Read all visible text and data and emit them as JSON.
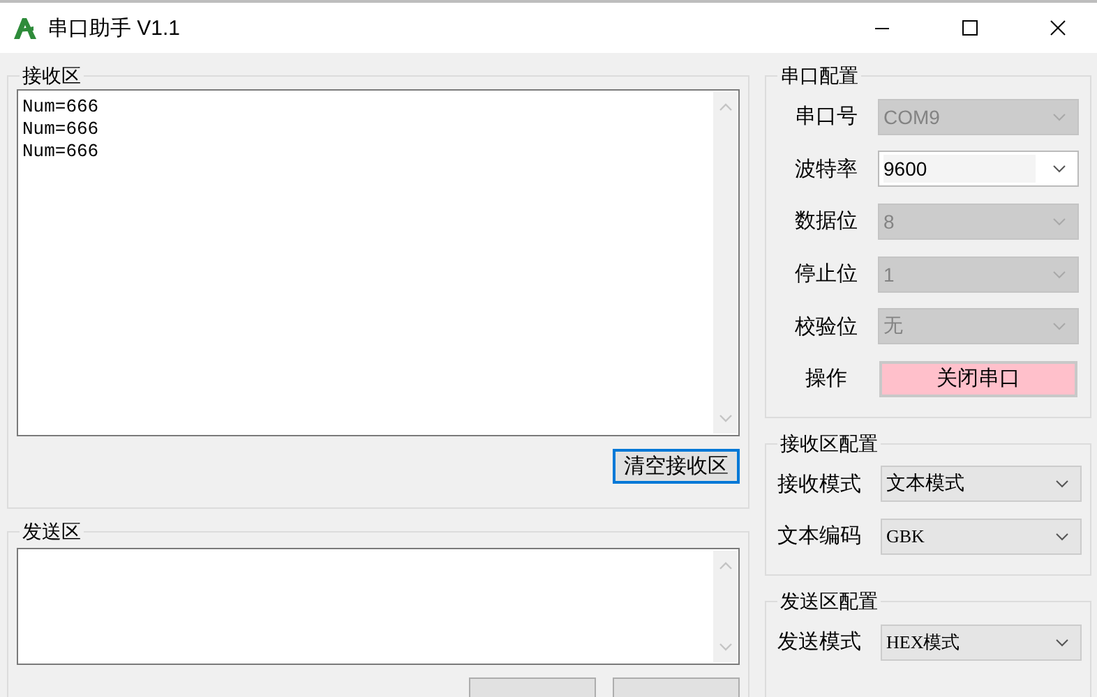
{
  "window": {
    "title": "串口助手 V1.1"
  },
  "receive_area": {
    "title": "接收区",
    "lines": [
      "Num=666",
      "Num=666",
      "Num=666"
    ],
    "clear_button": "清空接收区"
  },
  "send_area": {
    "title": "发送区"
  },
  "config_groups": [
    {
      "title": "串口配置",
      "rows": [
        {
          "label": "串口号",
          "kind": "combo",
          "value": "COM9",
          "disabled": true,
          "mono": false
        },
        {
          "label": "波特率",
          "kind": "editable",
          "value": "9600",
          "disabled": false,
          "mono": false
        },
        {
          "label": "数据位",
          "kind": "combo",
          "value": "8",
          "disabled": true,
          "mono": false
        },
        {
          "label": "停止位",
          "kind": "combo",
          "value": "1",
          "disabled": true,
          "mono": false
        },
        {
          "label": "校验位",
          "kind": "combo",
          "value": "无",
          "disabled": true,
          "mono": false
        },
        {
          "label": "操作",
          "kind": "button",
          "value": "关闭串口"
        }
      ]
    },
    {
      "title": "接收区配置",
      "rows": [
        {
          "label": "接收模式",
          "kind": "combo",
          "value": "文本模式",
          "disabled": false,
          "mono": false
        },
        {
          "label": "文本编码",
          "kind": "combo",
          "value": "GBK",
          "disabled": false,
          "mono": true
        }
      ]
    },
    {
      "title": "发送区配置",
      "rows": [
        {
          "label": "发送模式",
          "kind": "combo",
          "value": "HEX模式",
          "disabled": false,
          "mono": true
        }
      ]
    }
  ]
}
